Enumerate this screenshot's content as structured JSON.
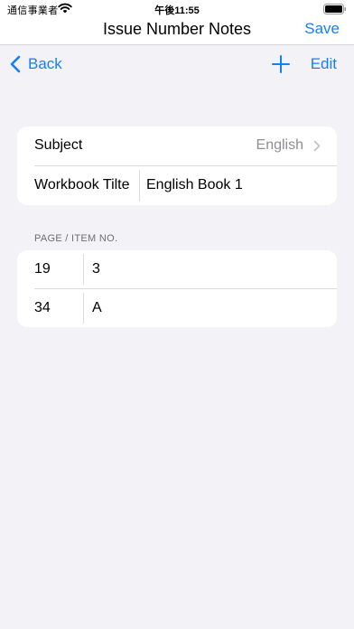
{
  "status_bar": {
    "carrier": "通信事業者",
    "time": "午後11:55"
  },
  "header": {
    "title": "Issue Number Notes",
    "save_label": "Save"
  },
  "nav": {
    "back_label": "Back",
    "edit_label": "Edit"
  },
  "details": {
    "subject_label": "Subject",
    "subject_value": "English",
    "workbook_label": "Workbook Tilte",
    "workbook_value": "English Book 1"
  },
  "pages_section": {
    "header": "PAGE / ITEM NO.",
    "rows": [
      {
        "page": "19",
        "item": "3"
      },
      {
        "page": "34",
        "item": "A"
      }
    ]
  },
  "colors": {
    "accent": "#147efb",
    "background": "#f2f2f7",
    "secondary_text": "#8e8e93"
  },
  "icons": [
    "wifi-icon",
    "battery-icon",
    "chevron-left-icon",
    "plus-icon",
    "chevron-right-icon"
  ]
}
